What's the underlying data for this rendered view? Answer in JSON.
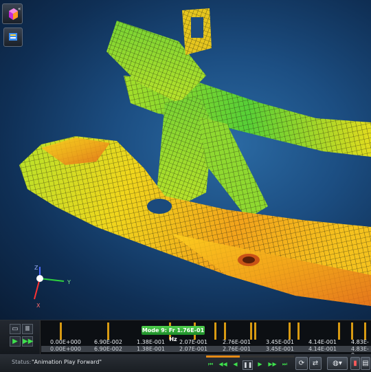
{
  "viewport": {
    "axis": {
      "x_label": "X",
      "y_label": "Y",
      "z_label": "Z"
    }
  },
  "timeline": {
    "mode_label": "Mode 9: Fr 1.76E-01 Hz",
    "scale_values": [
      "0.00E+000",
      "6.90E-002",
      "1.38E-001",
      "2.07E-001",
      "2.76E-001",
      "3.45E-001",
      "4.14E-001",
      "4.83E-0"
    ],
    "scale_values_row2": [
      "0.00E+000",
      "6.90E-002",
      "1.38E-001",
      "2.07E-001",
      "2.76E-001",
      "3.45E-001",
      "4.14E-001",
      "4.83E-0"
    ]
  },
  "status": {
    "label": "Status:",
    "text": "\"Animation Play Forward\""
  },
  "colors": {
    "accent": "#d89a12",
    "play": "#3ee04c",
    "mode_badge": "#2ea83a"
  }
}
